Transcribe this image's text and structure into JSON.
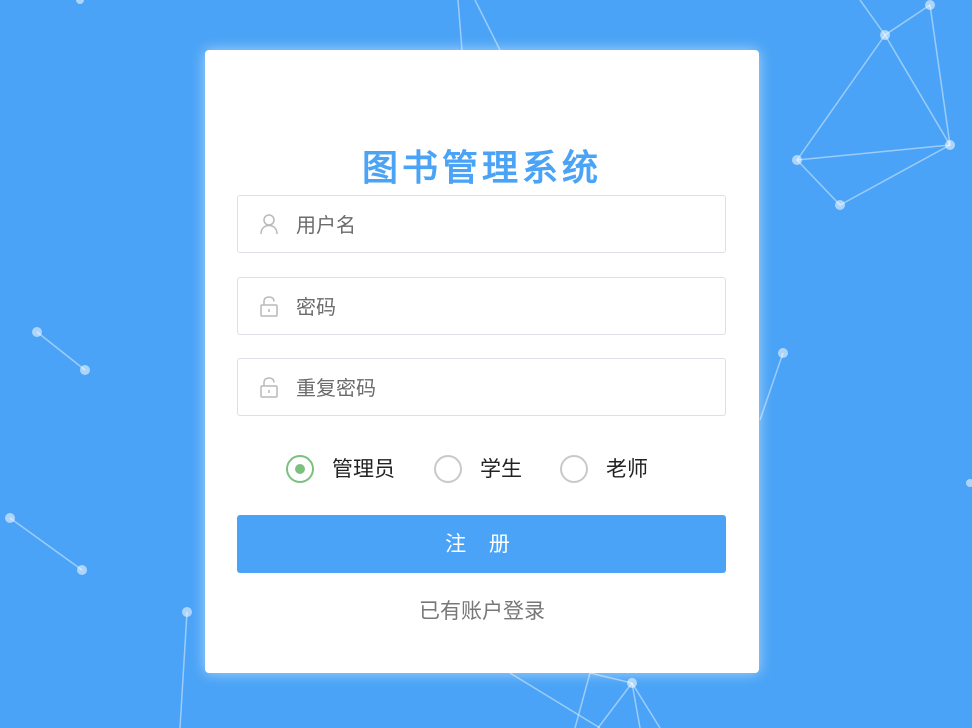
{
  "app": {
    "title": "图书管理系统"
  },
  "form": {
    "username": {
      "placeholder": "用户名",
      "value": ""
    },
    "password": {
      "placeholder": "密码",
      "value": ""
    },
    "confirm_password": {
      "placeholder": "重复密码",
      "value": ""
    }
  },
  "roles": {
    "selected": "管理员",
    "options": [
      {
        "label": "管理员"
      },
      {
        "label": "学生"
      },
      {
        "label": "老师"
      }
    ]
  },
  "actions": {
    "register_label": "注 册",
    "login_link": "已有账户登录"
  },
  "colors": {
    "background": "#4aa3f6",
    "accent": "#4aa3f6",
    "radio_checked": "#7cc07f",
    "card": "#ffffff"
  },
  "icons": {
    "username": "user-icon",
    "password": "lock-icon",
    "confirm_password": "lock-icon"
  }
}
